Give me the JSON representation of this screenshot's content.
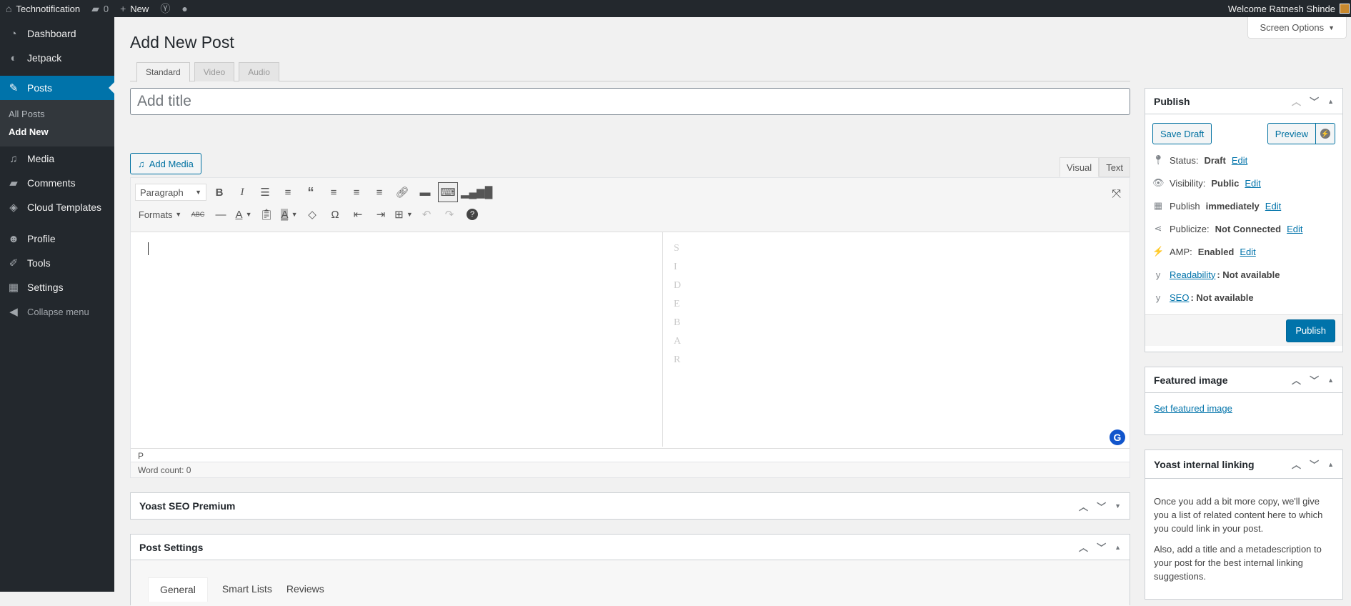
{
  "adminbar": {
    "site_name": "Technotification",
    "comments_count": "0",
    "new_label": "New",
    "welcome": "Welcome Ratnesh Shinde"
  },
  "sidebar": {
    "items": [
      {
        "label": "Dashboard",
        "icon": "dashboard-icon"
      },
      {
        "label": "Jetpack",
        "icon": "jetpack-icon"
      },
      {
        "label": "Posts",
        "icon": "pin-icon"
      },
      {
        "label": "Media",
        "icon": "media-icon"
      },
      {
        "label": "Comments",
        "icon": "comments-icon"
      },
      {
        "label": "Cloud Templates",
        "icon": "cloud-templates-icon"
      },
      {
        "label": "Profile",
        "icon": "profile-icon"
      },
      {
        "label": "Tools",
        "icon": "wrench-icon"
      },
      {
        "label": "Settings",
        "icon": "settings-icon"
      },
      {
        "label": "Collapse menu",
        "icon": "collapse-icon"
      }
    ],
    "submenu": [
      "All Posts",
      "Add New"
    ]
  },
  "screen_options": "Screen Options",
  "page_title": "Add New Post",
  "format_tabs": [
    "Standard",
    "Video",
    "Audio"
  ],
  "title_placeholder": "Add title",
  "add_media": "Add Media",
  "editor_tabs": [
    "Visual",
    "Text"
  ],
  "toolbar": {
    "paragraph": "Paragraph",
    "formats": "Formats"
  },
  "sidebar_letters": [
    "S",
    "I",
    "D",
    "E",
    "B",
    "A",
    "R"
  ],
  "path": "P",
  "word_count": "Word count: 0",
  "metaboxes": {
    "yoast_seo": "Yoast SEO Premium",
    "post_settings": "Post Settings",
    "post_settings_tabs": [
      "General",
      "Smart Lists",
      "Reviews"
    ]
  },
  "publish": {
    "title": "Publish",
    "save_draft": "Save Draft",
    "preview": "Preview",
    "status_label": "Status:",
    "status_value": "Draft",
    "visibility_label": "Visibility:",
    "visibility_value": "Public",
    "publish_label": "Publish",
    "publish_value": "immediately",
    "publicize_label": "Publicize:",
    "publicize_value": "Not Connected",
    "amp_label": "AMP:",
    "amp_value": "Enabled",
    "readability_link": "Readability",
    "readability_value": ": Not available",
    "seo_link": "SEO",
    "seo_value": ": Not available",
    "edit": "Edit",
    "publish_button": "Publish"
  },
  "featured_image": {
    "title": "Featured image",
    "link": "Set featured image"
  },
  "yoast_linking": {
    "title": "Yoast internal linking",
    "p1": "Once you add a bit more copy, we'll give you a list of related content here to which you could link in your post.",
    "p2": "Also, add a title and a metadescription to your post for the best internal linking suggestions."
  }
}
